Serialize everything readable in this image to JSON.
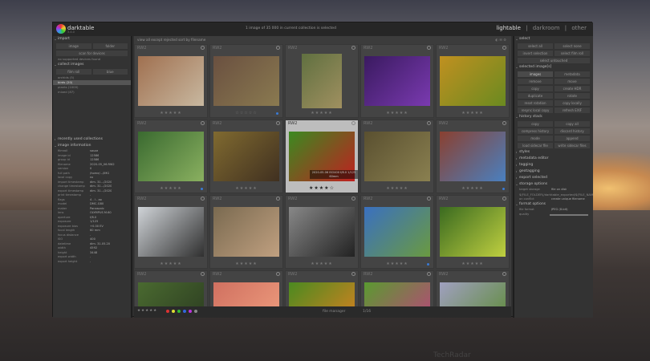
{
  "app": {
    "name": "darktable",
    "version": "3.4.0",
    "status": "1 image of 35 000 in current collection is selected",
    "views": [
      "lightable",
      "darkroom",
      "other"
    ],
    "active_view": "lightable"
  },
  "left": {
    "import": {
      "title": "import",
      "btn_image": "image",
      "btn_folder": "folder",
      "btn_scan": "scan for devices",
      "note": "no supported devices found"
    },
    "collect": {
      "title": "collect images",
      "rule": "film roll",
      "value": "blue",
      "items": [
        "orchids (5)",
        "birds (20)",
        "plants (1000)",
        "mixed (87)"
      ]
    },
    "recent": {
      "title": "recently used collections"
    },
    "info": {
      "title": "image information",
      "fields": [
        {
          "k": "filmroll",
          "v": "sauza"
        },
        {
          "k": "image id",
          "v": "12586"
        },
        {
          "k": "group id",
          "v": "12586"
        },
        {
          "k": "filename",
          "v": "2020-05_06.RW2"
        },
        {
          "k": "version",
          "v": "0"
        },
        {
          "k": "full path",
          "v": "/home/.../IMG"
        },
        {
          "k": "local copy",
          "v": "no"
        },
        {
          "k": "import timestamp",
          "v": "dim. 31.../2020"
        },
        {
          "k": "change timestamp",
          "v": "dim. 31.../2020"
        },
        {
          "k": "export timestamp",
          "v": "dim. 31.../2020"
        },
        {
          "k": "print timestamp",
          "v": "-"
        },
        {
          "k": "flags",
          "v": "4 - l - ao"
        },
        {
          "k": "model",
          "v": "DMC-G80"
        },
        {
          "k": "maker",
          "v": "Panasonic"
        },
        {
          "k": "lens",
          "v": "OLYMPUS M.60"
        },
        {
          "k": "aperture",
          "v": "f/8.0"
        },
        {
          "k": "exposure",
          "v": "1/125"
        },
        {
          "k": "exposure bias",
          "v": "+0.00 EV"
        },
        {
          "k": "focal length",
          "v": "60 mm"
        },
        {
          "k": "focus distance",
          "v": "-"
        },
        {
          "k": "ISO",
          "v": "400"
        },
        {
          "k": "datetime",
          "v": "dim. 31.05.20"
        },
        {
          "k": "width",
          "v": "4592"
        },
        {
          "k": "height",
          "v": "3448"
        },
        {
          "k": "export width",
          "v": "-"
        },
        {
          "k": "export height",
          "v": "-"
        }
      ]
    }
  },
  "center": {
    "filter_view": "view",
    "filter_value": "all except rejected",
    "sort_label": "sort by",
    "sort_value": "filename",
    "thumbs": [
      {
        "label": "RW2",
        "stars": "★★★★★",
        "c1": "#a07050",
        "c2": "#c8b8a0"
      },
      {
        "label": "RW2",
        "stars": "☆☆☆☆☆",
        "c1": "#6a5040",
        "c2": "#8a7a50"
      },
      {
        "label": "RW2",
        "stars": "★★★★★",
        "c1": "#607040",
        "c2": "#a09060"
      },
      {
        "label": "RW2",
        "stars": "★★★★★",
        "c1": "#3a1a60",
        "c2": "#7a3ab0"
      },
      {
        "label": "RW2",
        "stars": "★★★★★",
        "c1": "#c09020",
        "c2": "#6a8a20"
      },
      {
        "label": "RW2",
        "stars": "★★★★★",
        "c1": "#3a6a30",
        "c2": "#8ab060"
      },
      {
        "label": "RW2",
        "stars": "★★★★★",
        "c1": "#806a30",
        "c2": "#403020"
      },
      {
        "label": "RW2",
        "stars": "★★★★☆",
        "c1": "#3a8a20",
        "c2": "#c02020",
        "info": "2020-05-06 ISO400 f/8.0 1/125 60mm"
      },
      {
        "label": "RW2",
        "stars": "★★★★★",
        "c1": "#5a5030",
        "c2": "#8a8050"
      },
      {
        "label": "RW2",
        "stars": "★★★★★",
        "c1": "#8a4030",
        "c2": "#4a80c0"
      },
      {
        "label": "RW2",
        "stars": "★★★★★",
        "c1": "#d0d4d8",
        "c2": "#303030"
      },
      {
        "label": "RW2",
        "stars": "★★★★★",
        "c1": "#7a6a50",
        "c2": "#c0a080"
      },
      {
        "label": "RW2",
        "stars": "★★★★★",
        "c1": "#888888",
        "c2": "#222222"
      },
      {
        "label": "RW2",
        "stars": "★★★★★",
        "c1": "#3a70c0",
        "c2": "#6a9a40"
      },
      {
        "label": "RW2",
        "stars": "★★★★★",
        "c1": "#3a6a20",
        "c2": "#c0d040"
      },
      {
        "label": "RW2",
        "stars": "",
        "c1": "#4a6a30",
        "c2": "#2a3a20"
      },
      {
        "label": "RW2",
        "stars": "",
        "c1": "#d07060",
        "c2": "#f0a080"
      },
      {
        "label": "RW2",
        "stars": "",
        "c1": "#4a8a20",
        "c2": "#e08020"
      },
      {
        "label": "RW2",
        "stars": "",
        "c1": "#5a9a30",
        "c2": "#c04080"
      },
      {
        "label": "RW2",
        "stars": "",
        "c1": "#a0a0c0",
        "c2": "#5a8a30"
      }
    ],
    "bottom": {
      "stars": "★★★★★",
      "layout": "file manager",
      "zoom": "1/16",
      "colors": [
        "#d33",
        "#dd3",
        "#3b3",
        "#36d",
        "#b3d",
        "#888"
      ]
    }
  },
  "right": {
    "select": {
      "title": "select",
      "btns": [
        "select all",
        "select none",
        "invert selection",
        "select film roll",
        "select untouched"
      ]
    },
    "selected": {
      "title": "selected image[s]",
      "tab1": "images",
      "tab2": "metadata",
      "btns": [
        "remove",
        "move",
        "copy",
        "create HDR",
        "duplicate",
        "rotate",
        "reset rotation",
        "copy locally",
        "resync local copy",
        "refresh EXIF"
      ]
    },
    "history": {
      "title": "history stack",
      "btns": [
        "copy",
        "copy all",
        "compress history",
        "discard history",
        "mode",
        "append",
        "load sidecar file",
        "write sidecar files"
      ]
    },
    "modules": [
      "styles",
      "metadata editor",
      "tagging",
      "geotagging",
      "export selected"
    ],
    "options": {
      "title": "storage options",
      "target": "target storage",
      "target_v": "file on disk",
      "path": "$(FILE_FOLDER)/darktable_exported/$(FILE_NAME)",
      "conflict": "on conflict",
      "conflict_v": "create unique filename",
      "format": "format options",
      "file_format": "file format",
      "file_format_v": "JPEG (8-bit)",
      "quality": "quality"
    }
  },
  "watermark": "TechRadar"
}
